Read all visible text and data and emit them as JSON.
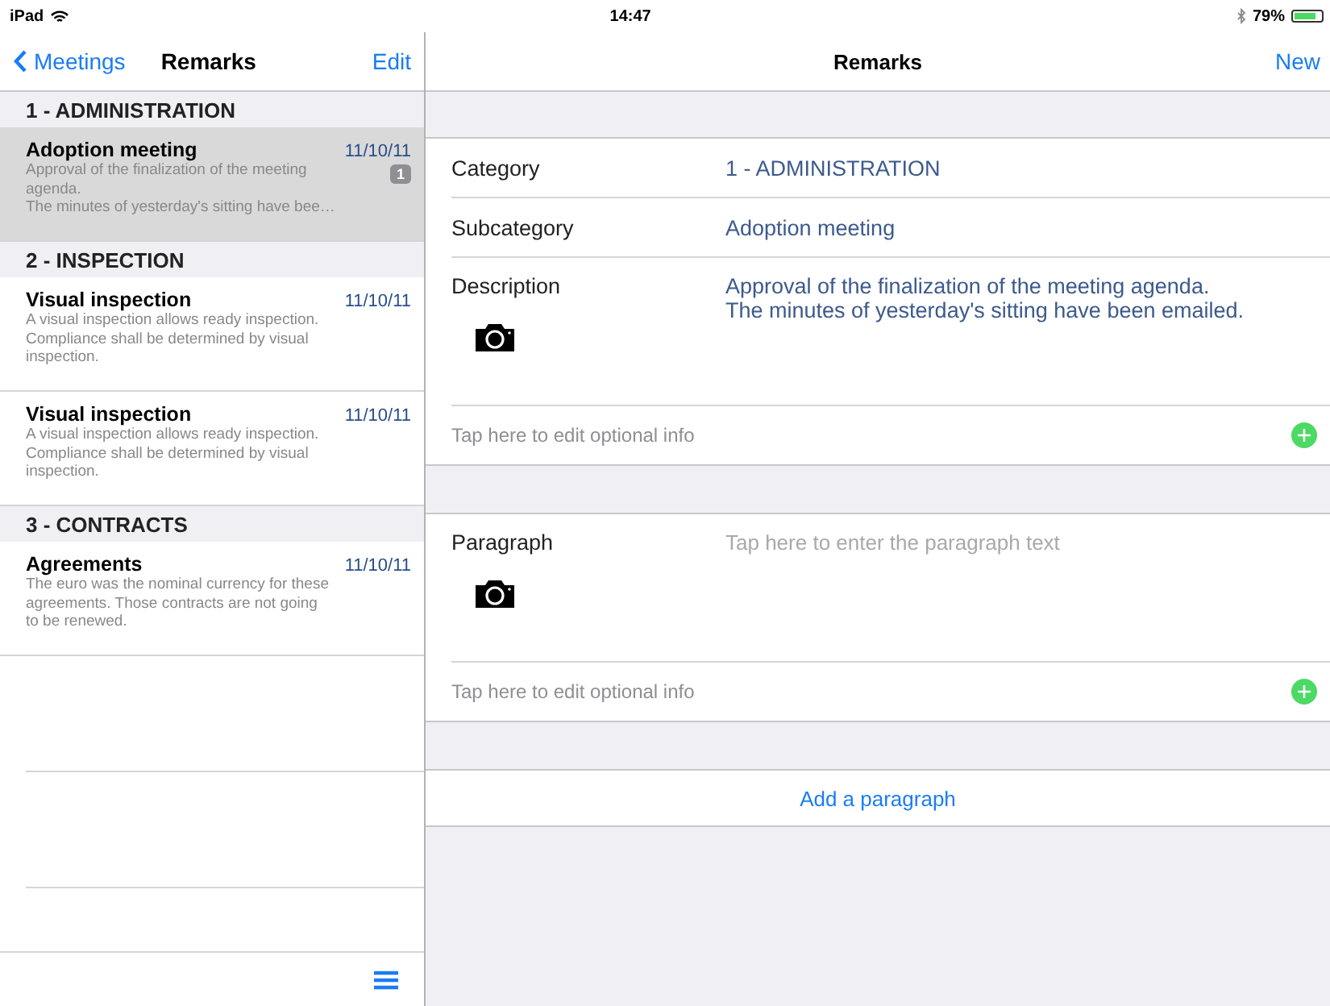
{
  "status_bar": {
    "device": "iPad",
    "time": "14:47",
    "battery": "79%",
    "battery_meter": {
      "level": 0.79
    }
  },
  "master": {
    "back": "Meetings",
    "title": "Remarks",
    "edit": "Edit",
    "sections": [
      {
        "title": "1 - ADMINISTRATION",
        "items": [
          {
            "title": "Adoption meeting",
            "date": "11/10/11",
            "text": "Approval of the finalization of the meeting\nagenda.\nThe minutes of yesterday's sitting have bee…",
            "badge": "1",
            "selected": true
          }
        ]
      },
      {
        "title": "2 - INSPECTION",
        "items": [
          {
            "title": "Visual inspection",
            "date": "11/10/11",
            "text": "A visual inspection allows ready inspection.\nCompliance shall be determined by visual\ninspection.",
            "selected": false
          },
          {
            "title": "Visual inspection",
            "date": "11/10/11",
            "text": "A visual inspection allows ready inspection.\nCompliance shall be determined by visual\ninspection.",
            "selected": false
          }
        ]
      },
      {
        "title": "3 - CONTRACTS",
        "items": [
          {
            "title": "Agreements",
            "date": "11/10/11",
            "text": "The euro was the nominal currency for these\nagreements. Those contracts are not going\nto be renewed.",
            "selected": false
          }
        ]
      }
    ]
  },
  "detail": {
    "title": "Remarks",
    "new": "New",
    "cards": [
      {
        "rows": [
          {
            "kind": "value",
            "label": "Category",
            "value": "1 - ADMINISTRATION"
          },
          {
            "kind": "value",
            "label": "Subcategory",
            "value": "Adoption meeting"
          },
          {
            "kind": "text",
            "label": "Description",
            "value": "Approval of the finalization of the meeting agenda.\nThe minutes of yesterday's sitting have been emailed."
          },
          {
            "kind": "optional",
            "placeholder": "Tap here to edit optional info"
          }
        ]
      },
      {
        "rows": [
          {
            "kind": "text",
            "label": "Paragraph",
            "placeholder": "Tap here to enter the paragraph text"
          },
          {
            "kind": "optional",
            "placeholder": "Tap here to edit optional info"
          }
        ]
      }
    ],
    "add_button": "Add a paragraph"
  }
}
